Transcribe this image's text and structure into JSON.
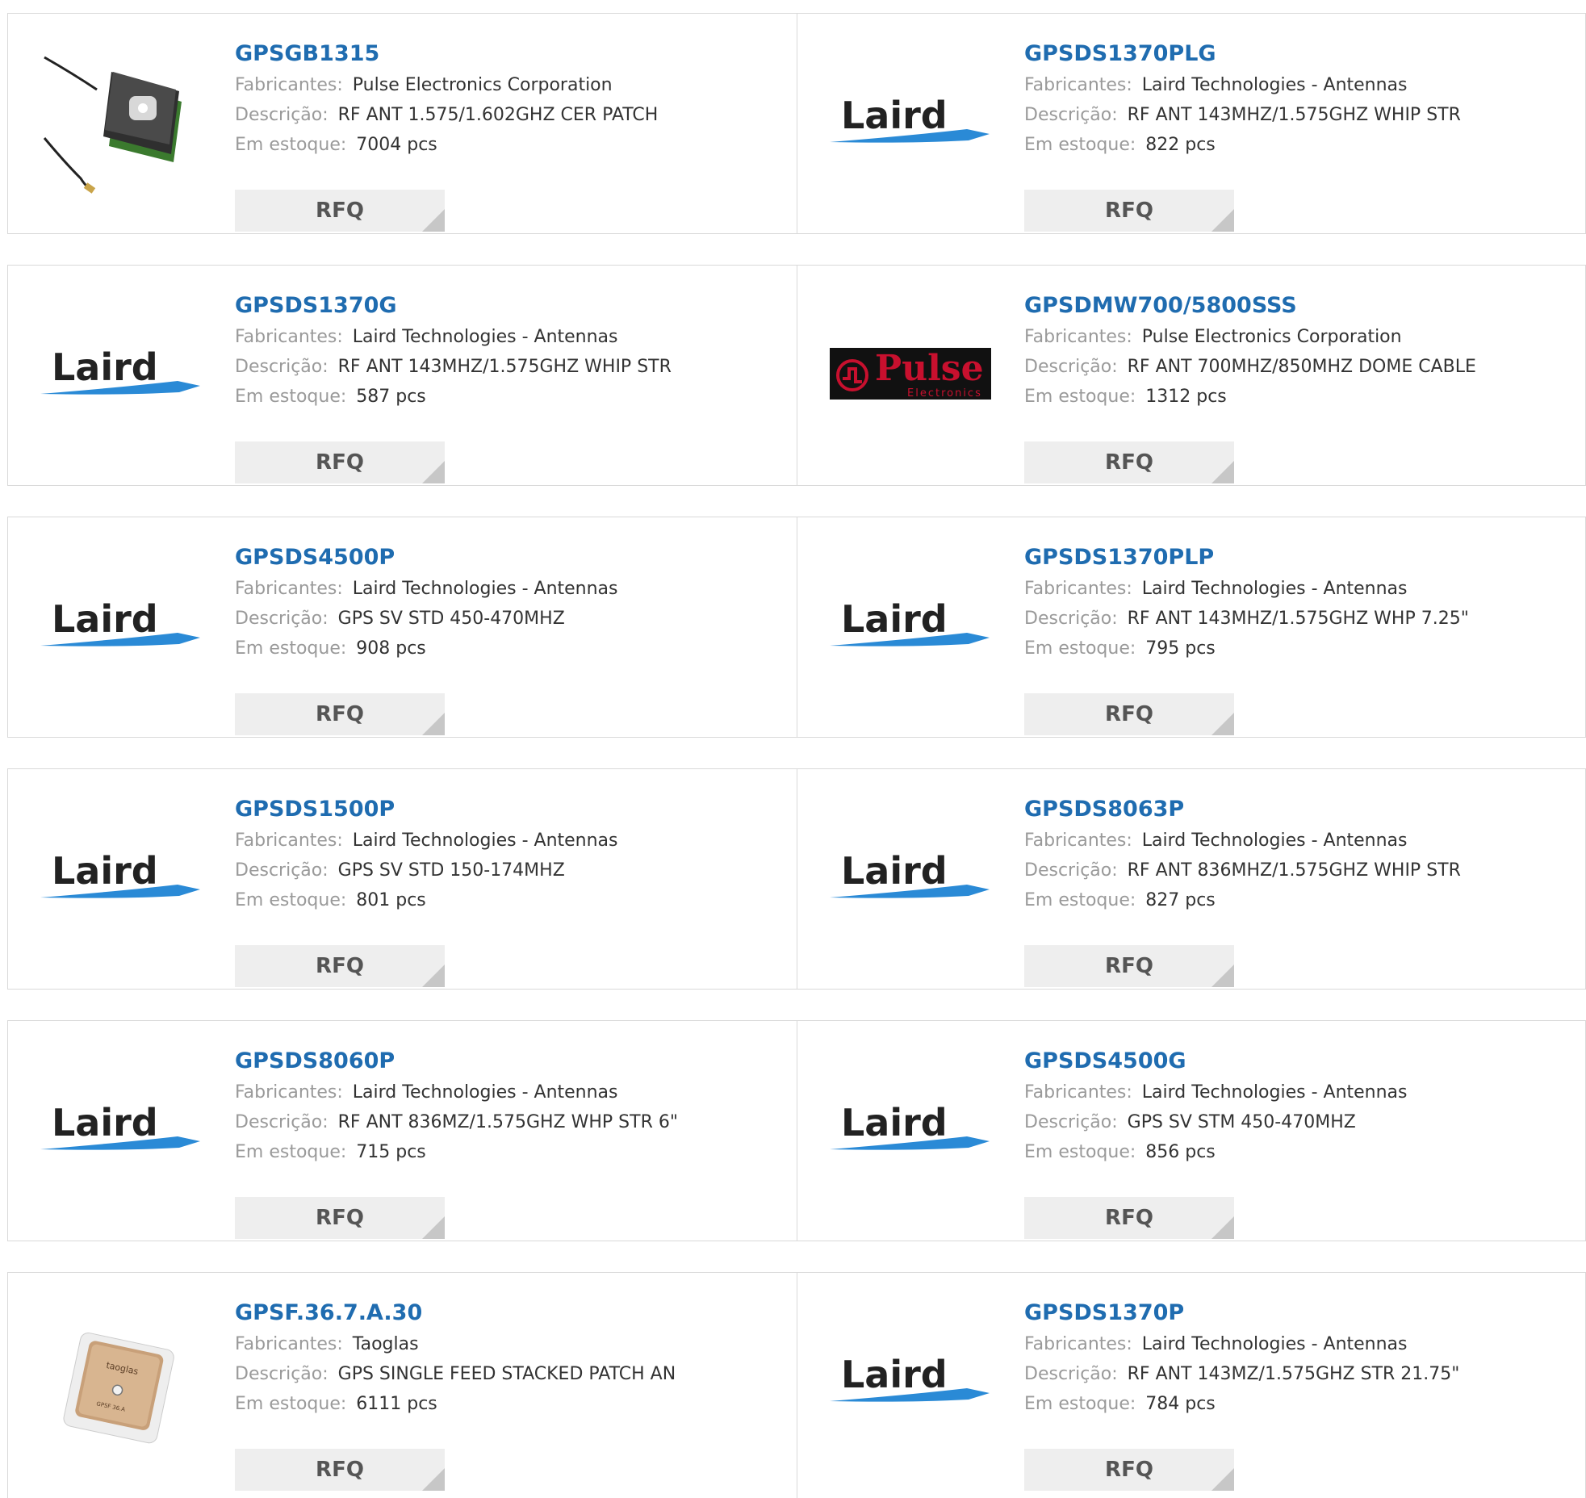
{
  "labels": {
    "manufacturer": "Fabricantes:",
    "description": "Descrição:",
    "stock": "Em estoque:",
    "rfq": "RFQ"
  },
  "products": [
    {
      "pn": "GPSGB1315",
      "mfr": "Pulse Electronics Corporation",
      "desc": "RF ANT 1.575/1.602GHZ CER PATCH",
      "stock": "7004 pcs",
      "image": "patch-antenna-cable"
    },
    {
      "pn": "GPSDS1370PLG",
      "mfr": "Laird Technologies - Antennas",
      "desc": "RF ANT 143MHZ/1.575GHZ WHIP STR",
      "stock": "822 pcs",
      "image": "laird-logo"
    },
    {
      "pn": "GPSDS1370G",
      "mfr": "Laird Technologies - Antennas",
      "desc": "RF ANT 143MHZ/1.575GHZ WHIP STR",
      "stock": "587 pcs",
      "image": "laird-logo"
    },
    {
      "pn": "GPSDMW700/5800SSS",
      "mfr": "Pulse Electronics Corporation",
      "desc": "RF ANT 700MHZ/850MHZ DOME CABLE",
      "stock": "1312 pcs",
      "image": "pulse-logo"
    },
    {
      "pn": "GPSDS4500P",
      "mfr": "Laird Technologies - Antennas",
      "desc": "GPS SV STD 450-470MHZ",
      "stock": "908 pcs",
      "image": "laird-logo"
    },
    {
      "pn": "GPSDS1370PLP",
      "mfr": "Laird Technologies - Antennas",
      "desc": "RF ANT 143MHZ/1.575GHZ WHP 7.25\"",
      "stock": "795 pcs",
      "image": "laird-logo"
    },
    {
      "pn": "GPSDS1500P",
      "mfr": "Laird Technologies - Antennas",
      "desc": "GPS SV STD 150-174MHZ",
      "stock": "801 pcs",
      "image": "laird-logo"
    },
    {
      "pn": "GPSDS8063P",
      "mfr": "Laird Technologies - Antennas",
      "desc": "RF ANT 836MHZ/1.575GHZ WHIP STR",
      "stock": "827 pcs",
      "image": "laird-logo"
    },
    {
      "pn": "GPSDS8060P",
      "mfr": "Laird Technologies - Antennas",
      "desc": "RF ANT 836MZ/1.575GHZ WHP STR 6\"",
      "stock": "715 pcs",
      "image": "laird-logo"
    },
    {
      "pn": "GPSDS4500G",
      "mfr": "Laird Technologies - Antennas",
      "desc": "GPS SV STM 450-470MHZ",
      "stock": "856 pcs",
      "image": "laird-logo"
    },
    {
      "pn": "GPSF.36.7.A.30",
      "mfr": "Taoglas",
      "desc": "GPS SINGLE FEED STACKED PATCH AN",
      "stock": "6111 pcs",
      "image": "taoglas-patch"
    },
    {
      "pn": "GPSDS1370P",
      "mfr": "Laird Technologies - Antennas",
      "desc": "RF ANT 143MZ/1.575GHZ STR 21.75\"",
      "stock": "784 pcs",
      "image": "laird-logo"
    }
  ],
  "logos": {
    "laird_text": "Laird",
    "pulse_text": "Pulse",
    "pulse_sub": "Electronics",
    "taoglas_text": "taoglas",
    "taoglas_part": "GPSF 36.A"
  }
}
